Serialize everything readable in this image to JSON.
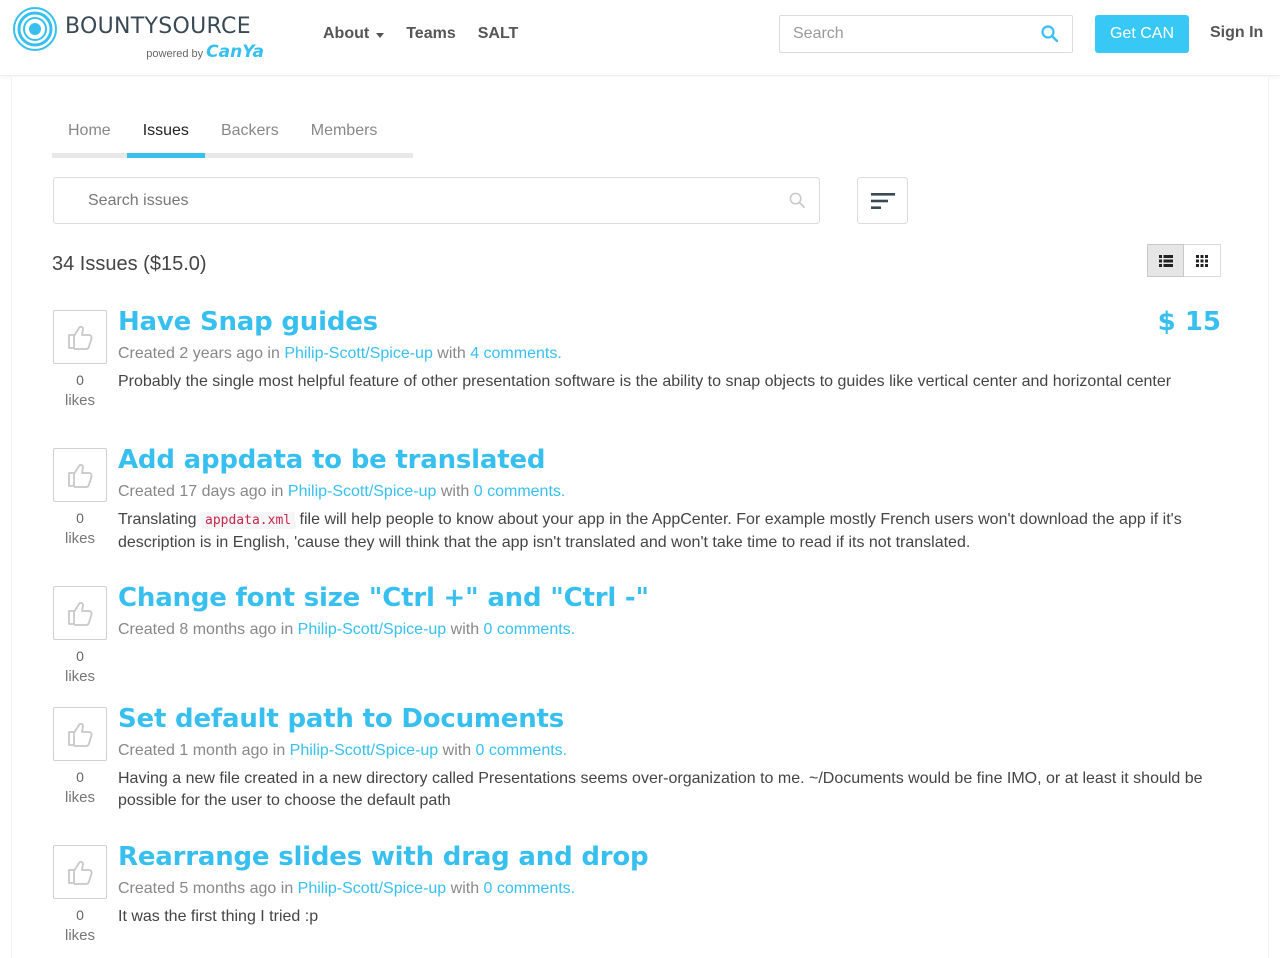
{
  "header": {
    "brand": "BOUNTYSOURCE",
    "powered_by": "powered by",
    "powered_brand": "CanYa",
    "nav": [
      {
        "label": "About",
        "has_dropdown": true
      },
      {
        "label": "Teams",
        "has_dropdown": false
      },
      {
        "label": "SALT",
        "has_dropdown": false
      }
    ],
    "search_placeholder": "Search",
    "get_can_label": "Get CAN",
    "sign_in_label": "Sign In"
  },
  "tabs": [
    {
      "label": "Home",
      "active": false
    },
    {
      "label": "Issues",
      "active": true
    },
    {
      "label": "Backers",
      "active": false
    },
    {
      "label": "Members",
      "active": false
    }
  ],
  "issue_search_placeholder": "Search issues",
  "summary": "34 Issues ($15.0)",
  "issues": [
    {
      "title": "Have Snap guides",
      "bounty": "$ 15",
      "created": "Created 2 years ago in ",
      "repo": "Philip-Scott/Spice-up",
      "with": " with ",
      "comments": "4 comments.",
      "likes": "0",
      "likes_label": "likes",
      "body_pre": "Probably the single most helpful feature of other presentation software is the ability to snap objects to guides like vertical center and horizontal center",
      "body_code": "",
      "body_post": ""
    },
    {
      "title": "Add appdata to be translated",
      "bounty": "",
      "created": "Created 17 days ago in ",
      "repo": "Philip-Scott/Spice-up",
      "with": " with ",
      "comments": "0 comments.",
      "likes": "0",
      "likes_label": "likes",
      "body_pre": "Translating ",
      "body_code": "appdata.xml",
      "body_post": " file will help people to know about your app in the AppCenter. For example mostly French users won't download the app if it's description is in English, 'cause they will think that the app isn't translated and won't take time to read if its not translated."
    },
    {
      "title": "Change font size \"Ctrl +\" and \"Ctrl -\"",
      "bounty": "",
      "created": "Created 8 months ago in ",
      "repo": "Philip-Scott/Spice-up",
      "with": " with ",
      "comments": "0 comments.",
      "likes": "0",
      "likes_label": "likes",
      "body_pre": "",
      "body_code": "",
      "body_post": ""
    },
    {
      "title": "Set default path to Documents",
      "bounty": "",
      "created": "Created 1 month ago in ",
      "repo": "Philip-Scott/Spice-up",
      "with": " with ",
      "comments": "0 comments.",
      "likes": "0",
      "likes_label": "likes",
      "body_pre": "Having a new file created in a new directory called Presentations seems over-organization to me. ~/Documents would be fine IMO, or at least it should be possible for the user to choose the default path",
      "body_code": "",
      "body_post": ""
    },
    {
      "title": "Rearrange slides with drag and drop",
      "bounty": "",
      "created": "Created 5 months ago in ",
      "repo": "Philip-Scott/Spice-up",
      "with": " with ",
      "comments": "0 comments.",
      "likes": "0",
      "likes_label": "likes",
      "body_pre": "It was the first thing I tried :p",
      "body_code": "",
      "body_post": ""
    }
  ],
  "colors": {
    "accent": "#37c0ef",
    "button": "#37c8f5",
    "code": "#c7254e"
  },
  "icons": [
    "bountysource-logo-icon",
    "caret-down-icon",
    "search-icon",
    "sort-icon",
    "list-view-icon",
    "grid-view-icon",
    "thumbs-up-icon"
  ]
}
